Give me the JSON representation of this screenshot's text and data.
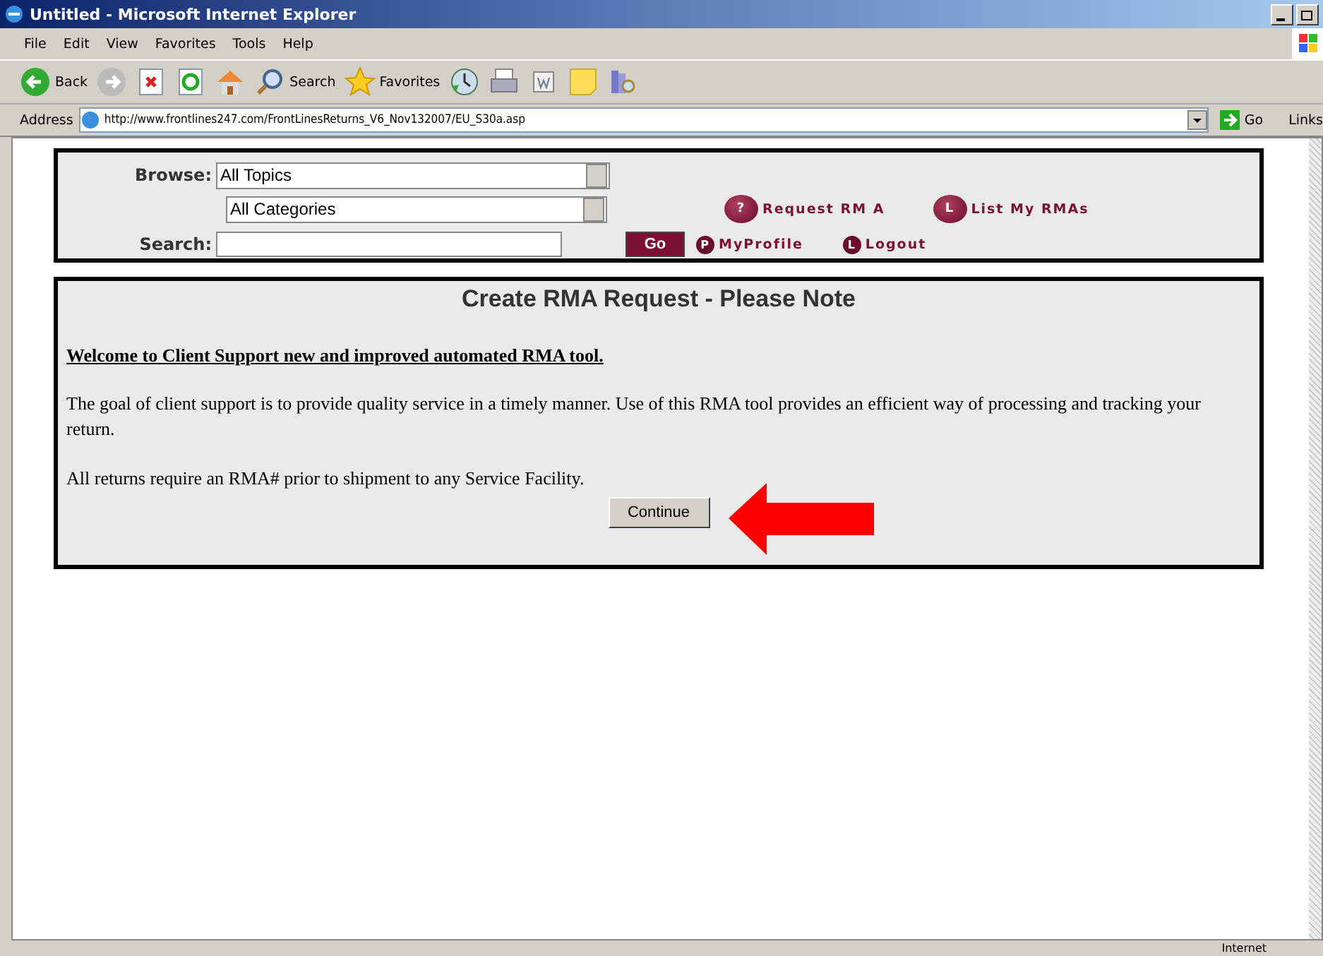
{
  "window": {
    "title": "Untitled - Microsoft Internet Explorer"
  },
  "menu": [
    "File",
    "Edit",
    "View",
    "Favorites",
    "Tools",
    "Help"
  ],
  "toolbar": [
    {
      "kind": "back",
      "label": "Back"
    },
    {
      "kind": "forward"
    },
    {
      "kind": "stop"
    },
    {
      "kind": "refresh"
    },
    {
      "kind": "home"
    },
    {
      "kind": "search",
      "label": "Search"
    },
    {
      "kind": "favorites",
      "label": "Favorites"
    },
    {
      "kind": "history"
    },
    {
      "kind": "print"
    },
    {
      "kind": "word"
    },
    {
      "kind": "note"
    },
    {
      "kind": "research"
    }
  ],
  "address": {
    "label": "Address",
    "value": "http://www.frontlines247.com/FrontLinesReturns_V6_Nov132007/EU_S30a.asp",
    "go": "Go",
    "links": "Links"
  },
  "nav": {
    "browse_label": "Browse:",
    "topic": "All Topics",
    "category": "All Categories",
    "search_label": "Search:",
    "go": "Go",
    "links": [
      {
        "icon": "?",
        "label": "Request RM A"
      },
      {
        "icon": "L",
        "label": "List My RMAs"
      },
      {
        "icon": "P",
        "label": "MyProfile"
      },
      {
        "icon": "L",
        "label": "Logout"
      }
    ]
  },
  "notice": {
    "title": "Create RMA Request - Please Note",
    "heading": "Welcome to Client Support new and improved automated RMA tool.",
    "paragraphs": [
      "The goal of client support is to provide quality service in a timely manner. Use of this RMA tool provides an efficient way of processing and tracking your return.",
      "All returns require an RMA# prior to shipment to any Service Facility."
    ],
    "button": "Continue"
  },
  "status_bar": {
    "zone": "Internet"
  }
}
